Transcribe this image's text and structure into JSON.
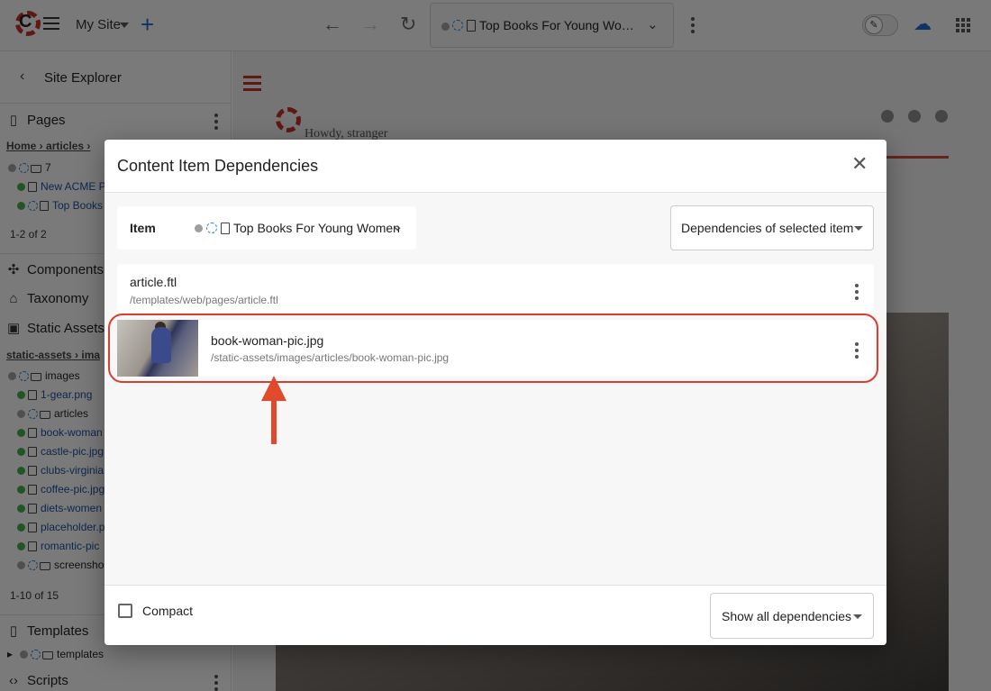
{
  "topbar": {
    "site_name": "My Site",
    "address_text": "Top Books For Young Wo…",
    "icons": [
      "crafter-logo-icon",
      "menu-icon",
      "add-icon",
      "back-icon",
      "forward-icon",
      "reload-icon",
      "more-icon",
      "edit-mode-icon",
      "publish-icon",
      "apps-icon"
    ]
  },
  "sidebar": {
    "title": "Site Explorer",
    "pages": {
      "label": "Pages",
      "breadcrumb": [
        "Home",
        "articles"
      ],
      "items": [
        {
          "label": "7",
          "status": "gray"
        },
        {
          "label": "New ACME Pl",
          "status": "green"
        },
        {
          "label": "Top Books",
          "status": "green"
        }
      ],
      "pager": "1-2 of 2"
    },
    "components_label": "Components",
    "taxonomy_label": "Taxonomy",
    "static_assets": {
      "label": "Static Assets",
      "breadcrumb": [
        "static-assets",
        "ima"
      ],
      "items": [
        {
          "label": "images",
          "status": "gray"
        },
        {
          "label": "1-gear.png",
          "status": "green"
        },
        {
          "label": "articles",
          "status": "gray"
        },
        {
          "label": "book-woman",
          "status": "green"
        },
        {
          "label": "castle-pic.jpg",
          "status": "green"
        },
        {
          "label": "clubs-virginia",
          "status": "green"
        },
        {
          "label": "coffee-pic.jpg",
          "status": "green"
        },
        {
          "label": "diets-women",
          "status": "green"
        },
        {
          "label": "placeholder.p",
          "status": "green"
        },
        {
          "label": "romantic-pic",
          "status": "green"
        },
        {
          "label": "screensho",
          "status": "gray"
        }
      ],
      "pager": "1-10 of 15"
    },
    "templates": {
      "label": "Templates",
      "item": "templates"
    },
    "scripts_label": "Scripts"
  },
  "preview": {
    "greeting": "Howdy, stranger"
  },
  "dialog": {
    "title": "Content Item Dependencies",
    "item_label": "Item",
    "item_name": "Top Books For Young Women",
    "filter_select": "Dependencies of selected item",
    "dependencies": [
      {
        "name": "article.ftl",
        "path": "/templates/web/pages/article.ftl"
      },
      {
        "name": "book-woman-pic.jpg",
        "path": "/static-assets/images/articles/book-woman-pic.jpg"
      }
    ],
    "compact_label": "Compact",
    "compact_checked": false,
    "show_select": "Show all dependencies"
  },
  "colors": {
    "accent_blue": "#1f66c9",
    "brand_red": "#c0302a",
    "highlight_red": "#d5412f",
    "status_green": "#47a84c"
  }
}
